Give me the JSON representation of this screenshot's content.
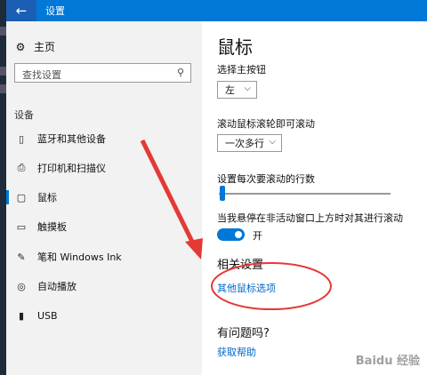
{
  "window": {
    "title": "设置",
    "back_glyph": "←"
  },
  "sidebar": {
    "home_label": "主页",
    "search_placeholder": "查找设置",
    "section_title": "设备",
    "items": [
      {
        "label": "蓝牙和其他设备",
        "icon": "bluetooth-icon"
      },
      {
        "label": "打印机和扫描仪",
        "icon": "printer-icon"
      },
      {
        "label": "鼠标",
        "icon": "mouse-icon",
        "active": true
      },
      {
        "label": "触摸板",
        "icon": "touchpad-icon"
      },
      {
        "label": "笔和 Windows Ink",
        "icon": "pen-icon"
      },
      {
        "label": "自动播放",
        "icon": "autoplay-icon"
      },
      {
        "label": "USB",
        "icon": "usb-icon"
      }
    ]
  },
  "main": {
    "title": "鼠标",
    "primary_button": {
      "label": "选择主按钮",
      "value": "左"
    },
    "wheel_scroll": {
      "label": "滚动鼠标滚轮即可滚动",
      "value": "一次多行"
    },
    "lines_to_scroll": {
      "label": "设置每次要滚动的行数",
      "level": 0.03
    },
    "inactive_scroll": {
      "label": "当我悬停在非活动窗口上方时对其进行滚动",
      "state": "开"
    },
    "related": {
      "title": "相关设置",
      "link": "其他鼠标选项"
    },
    "help": {
      "title": "有问题吗?",
      "link": "获取帮助"
    }
  },
  "annotation": {
    "color": "#e53935"
  },
  "watermark": "Baidu 经验"
}
